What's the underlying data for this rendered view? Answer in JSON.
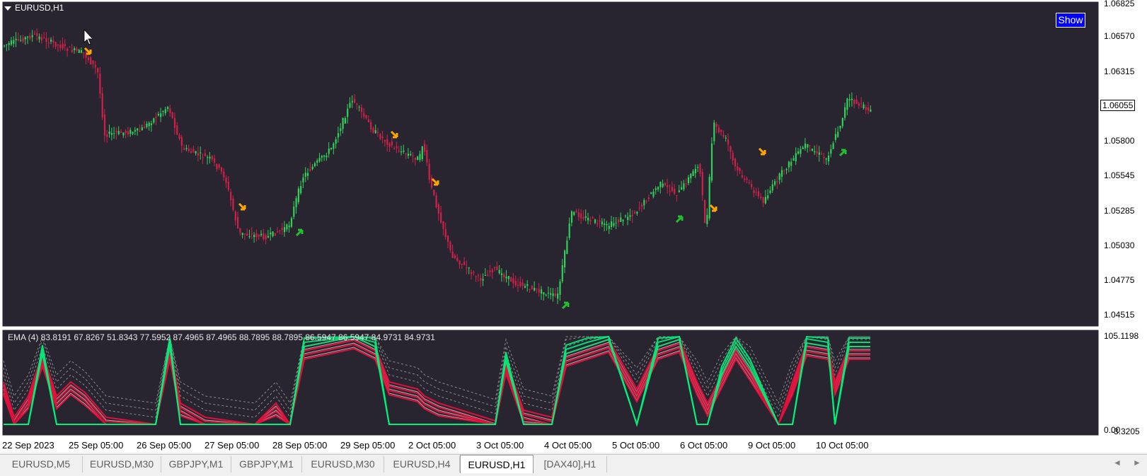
{
  "chart": {
    "symbol": "EURUSD,H1",
    "show_button": "Show",
    "current_price": "1.06055",
    "price_axis": [
      "1.06825",
      "1.06570",
      "1.06315",
      "1.05800",
      "1.05545",
      "1.05285",
      "1.05030",
      "1.04775",
      "1.04515"
    ],
    "time_axis": [
      "22 Sep 2023",
      "25 Sep 05:00",
      "26 Sep 05:00",
      "27 Sep 05:00",
      "28 Sep 05:00",
      "29 Sep 05:00",
      "2 Oct 05:00",
      "3 Oct 05:00",
      "4 Oct 05:00",
      "5 Oct 05:00",
      "6 Oct 05:00",
      "9 Oct 05:00",
      "10 Oct 05:00"
    ],
    "colors": {
      "background": "#282530",
      "bull": "#2fd15a",
      "bear": "#d0204a",
      "buy_arrow": "#22c02e",
      "sell_arrow": "#ffa500",
      "ema_green": "#00f07a",
      "ema_red": "#e0103c"
    }
  },
  "indicator": {
    "label": "EMA (4) 83.8191 67.8267 51.8343 77.5952 87.4965 87.4965 88.7895 88.7895 86.5947 86.5947 84.9731 84.9731",
    "max": "105.1198",
    "min": "0.00",
    "min_overlap": "-3.3205"
  },
  "tabs": [
    {
      "label": "EURUSD,M5",
      "active": false
    },
    {
      "label": "EURUSD,M30",
      "active": false
    },
    {
      "label": "GBPJPY,M1",
      "active": false
    },
    {
      "label": "GBPJPY,M1",
      "active": false
    },
    {
      "label": "EURUSD,M30",
      "active": false
    },
    {
      "label": "EURUSD,H4",
      "active": false
    },
    {
      "label": "EURUSD,H1",
      "active": true
    },
    {
      "label": "[DAX40],H1",
      "active": false
    }
  ],
  "tab_nav": {
    "left": "◄",
    "right": "►"
  }
}
